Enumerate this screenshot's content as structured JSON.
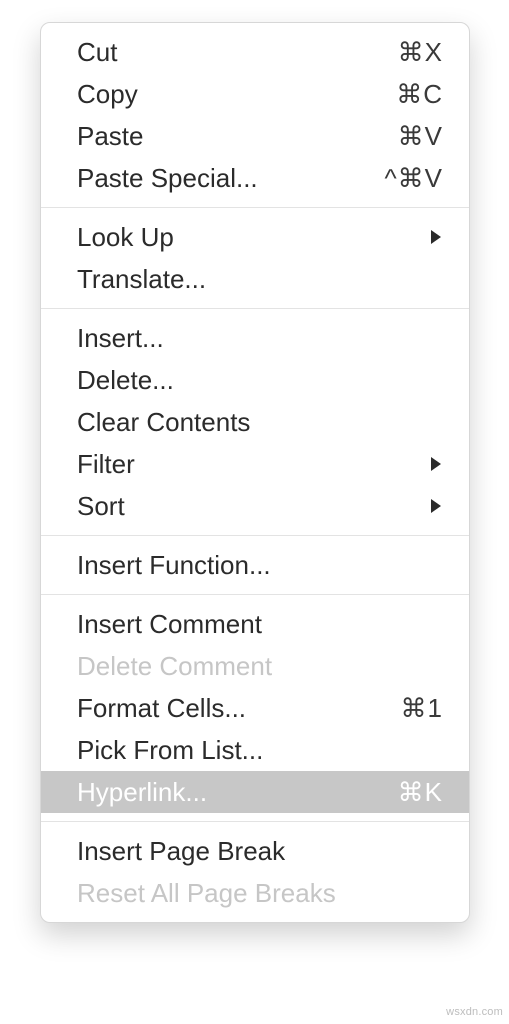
{
  "menu": {
    "groups": [
      [
        {
          "label": "Cut",
          "shortcut": "⌘X",
          "submenu": false,
          "disabled": false,
          "highlighted": false
        },
        {
          "label": "Copy",
          "shortcut": "⌘C",
          "submenu": false,
          "disabled": false,
          "highlighted": false
        },
        {
          "label": "Paste",
          "shortcut": "⌘V",
          "submenu": false,
          "disabled": false,
          "highlighted": false
        },
        {
          "label": "Paste Special...",
          "shortcut": "^⌘V",
          "submenu": false,
          "disabled": false,
          "highlighted": false
        }
      ],
      [
        {
          "label": "Look Up",
          "shortcut": "",
          "submenu": true,
          "disabled": false,
          "highlighted": false
        },
        {
          "label": "Translate...",
          "shortcut": "",
          "submenu": false,
          "disabled": false,
          "highlighted": false
        }
      ],
      [
        {
          "label": "Insert...",
          "shortcut": "",
          "submenu": false,
          "disabled": false,
          "highlighted": false
        },
        {
          "label": "Delete...",
          "shortcut": "",
          "submenu": false,
          "disabled": false,
          "highlighted": false
        },
        {
          "label": "Clear Contents",
          "shortcut": "",
          "submenu": false,
          "disabled": false,
          "highlighted": false
        },
        {
          "label": "Filter",
          "shortcut": "",
          "submenu": true,
          "disabled": false,
          "highlighted": false
        },
        {
          "label": "Sort",
          "shortcut": "",
          "submenu": true,
          "disabled": false,
          "highlighted": false
        }
      ],
      [
        {
          "label": "Insert Function...",
          "shortcut": "",
          "submenu": false,
          "disabled": false,
          "highlighted": false
        }
      ],
      [
        {
          "label": "Insert Comment",
          "shortcut": "",
          "submenu": false,
          "disabled": false,
          "highlighted": false
        },
        {
          "label": "Delete Comment",
          "shortcut": "",
          "submenu": false,
          "disabled": true,
          "highlighted": false
        },
        {
          "label": "Format Cells...",
          "shortcut": "⌘1",
          "submenu": false,
          "disabled": false,
          "highlighted": false
        },
        {
          "label": "Pick From List...",
          "shortcut": "",
          "submenu": false,
          "disabled": false,
          "highlighted": false
        },
        {
          "label": "Hyperlink...",
          "shortcut": "⌘K",
          "submenu": false,
          "disabled": false,
          "highlighted": true
        }
      ],
      [
        {
          "label": "Insert Page Break",
          "shortcut": "",
          "submenu": false,
          "disabled": false,
          "highlighted": false
        },
        {
          "label": "Reset All Page Breaks",
          "shortcut": "",
          "submenu": false,
          "disabled": true,
          "highlighted": false
        }
      ]
    ]
  },
  "watermark": "wsxdn.com"
}
